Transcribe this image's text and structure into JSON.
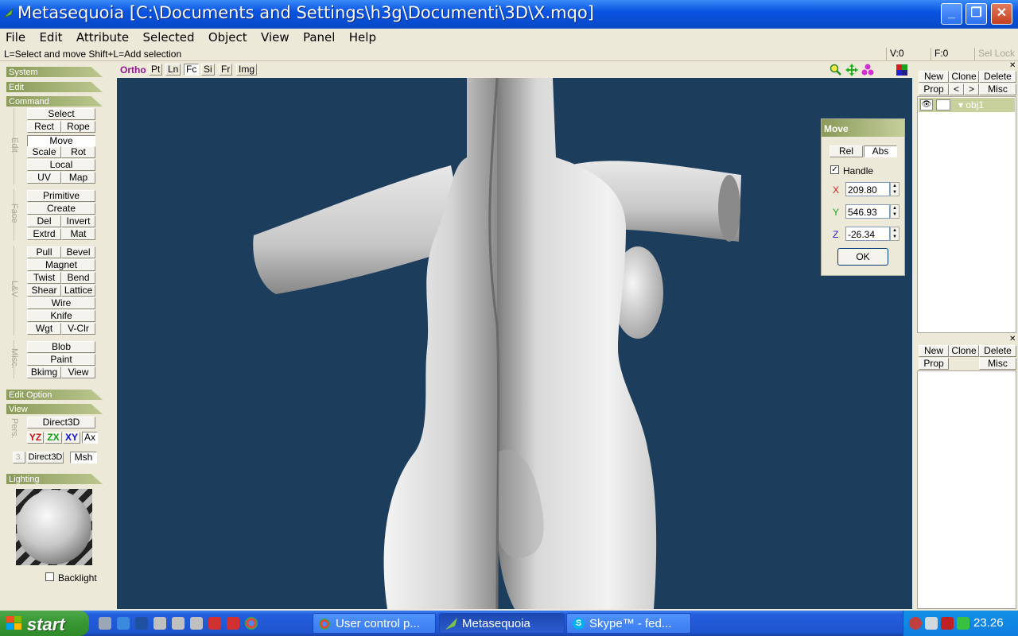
{
  "window": {
    "title": "Metasequoia [C:\\Documents and Settings\\h3g\\Documenti\\3D\\X.mqo]"
  },
  "menu": [
    "File",
    "Edit",
    "Attribute",
    "Selected",
    "Object",
    "View",
    "Panel",
    "Help"
  ],
  "status": {
    "hint": "L=Select and move  Shift+L=Add selection",
    "vertices": "V:0",
    "faces": "F:0",
    "sel_lock": "Sel Lock"
  },
  "left": {
    "sections": {
      "system": "System",
      "edit": "Edit",
      "command": "Command",
      "edit_option": "Edit Option",
      "view": "View",
      "lighting": "Lighting"
    },
    "groups": {
      "edit": "Edit",
      "face": "Face",
      "lv": "L&V",
      "misc": "Misc."
    },
    "buttons": {
      "select": "Select",
      "rect": "Rect",
      "rope": "Rope",
      "move": "Move",
      "scale": "Scale",
      "rot": "Rot",
      "local": "Local",
      "uv": "UV",
      "map": "Map",
      "primitive": "Primitive",
      "create": "Create",
      "del": "Del",
      "invert": "Invert",
      "extrd": "Extrd",
      "mat": "Mat",
      "pull": "Pull",
      "bevel": "Bevel",
      "magnet": "Magnet",
      "twist": "Twist",
      "bend": "Bend",
      "shear": "Shear",
      "lattice": "Lattice",
      "wire": "Wire",
      "knife": "Knife",
      "wgt": "Wgt",
      "vclr": "V-Clr",
      "blob": "Blob",
      "paint": "Paint",
      "bkimg": "Bkimg",
      "view": "View"
    },
    "view": {
      "pers": "Pers.",
      "direct3d": "Direct3D",
      "yz": "YZ",
      "zx": "ZX",
      "xy": "XY",
      "ax": "Ax",
      "three": "3.",
      "direct3d2": "Direct3D",
      "msh": "Msh"
    },
    "backlight": "Backlight"
  },
  "viewport_toolbar": {
    "ortho": "Ortho",
    "pt": "Pt",
    "ln": "Ln",
    "fc": "Fc",
    "si": "Si",
    "fr": "Fr",
    "img": "Img"
  },
  "move_dialog": {
    "title": "Move",
    "rel": "Rel",
    "abs": "Abs",
    "handle": "Handle",
    "x_label": "X",
    "y_label": "Y",
    "z_label": "Z",
    "x": "209.80",
    "y": "546.93",
    "z": "-26.34",
    "ok": "OK"
  },
  "object_panel": {
    "new": "New",
    "clone": "Clone",
    "delete": "Delete",
    "prop": "Prop",
    "prev": "<",
    "next": ">",
    "misc": "Misc",
    "objects": [
      {
        "name": "obj1"
      }
    ]
  },
  "material_panel": {
    "new": "New",
    "clone": "Clone",
    "delete": "Delete",
    "prop": "Prop",
    "misc": "Misc"
  },
  "taskbar": {
    "start": "start",
    "tasks": [
      {
        "label": "User control p..."
      },
      {
        "label": "Metasequoia"
      },
      {
        "label": "Skype™ - fed..."
      }
    ],
    "clock": "23.26"
  },
  "colors": {
    "viewport_bg": "#1c3e5c",
    "section_green": "#8a9a58",
    "taskbar_blue": "#245edb"
  }
}
